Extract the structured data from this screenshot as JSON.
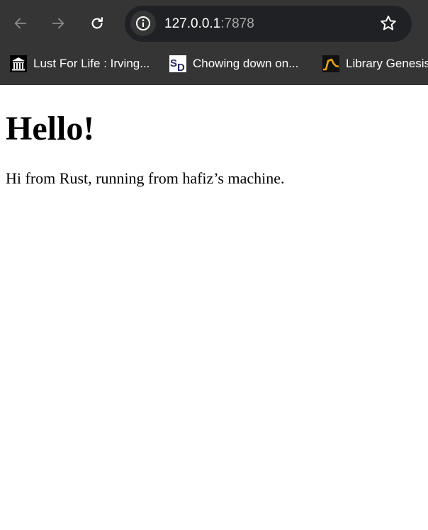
{
  "browser": {
    "url_host": "127.0.0.1",
    "url_port": ":7878",
    "bookmarks": [
      {
        "label": "Lust For Life : Irving...",
        "icon": "archive-temple-icon"
      },
      {
        "label": "Chowing down on...",
        "icon": "sd-logo-icon"
      },
      {
        "label": "Library Genesis",
        "icon": "libgen-icon"
      }
    ],
    "colors": {
      "chrome_bg": "#353535",
      "omnibox_bg": "#202124",
      "text": "#ffffff",
      "muted": "#a8a8a8"
    }
  },
  "page": {
    "heading": "Hello!",
    "paragraph": "Hi from Rust, running from hafiz’s machine."
  }
}
